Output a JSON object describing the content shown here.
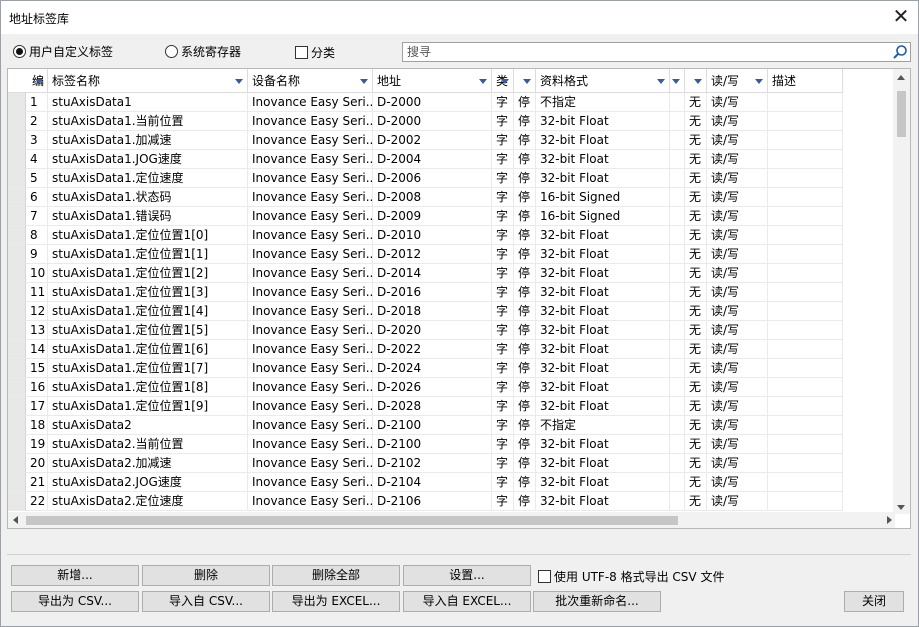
{
  "window": {
    "title": "地址标签库"
  },
  "options": {
    "user_tags_label": "用户自定义标签",
    "system_regs_label": "系统寄存器",
    "category_label": "分类",
    "search_placeholder": "搜寻"
  },
  "columns": [
    "编",
    "标签名称",
    "设备名称",
    "地址",
    "类",
    "",
    "资料格式",
    "",
    "",
    "读/写",
    "描述"
  ],
  "rows": [
    [
      "1",
      "stuAxisData1",
      "Inovance Easy Seri...",
      "D-2000",
      "字",
      "停",
      "不指定",
      "",
      "无",
      "读/写",
      ""
    ],
    [
      "2",
      "stuAxisData1.当前位置",
      "Inovance Easy Seri...",
      "D-2000",
      "字",
      "停",
      "32-bit Float",
      "",
      "无",
      "读/写",
      ""
    ],
    [
      "3",
      "stuAxisData1.加减速",
      "Inovance Easy Seri...",
      "D-2002",
      "字",
      "停",
      "32-bit Float",
      "",
      "无",
      "读/写",
      ""
    ],
    [
      "4",
      "stuAxisData1.JOG速度",
      "Inovance Easy Seri...",
      "D-2004",
      "字",
      "停",
      "32-bit Float",
      "",
      "无",
      "读/写",
      ""
    ],
    [
      "5",
      "stuAxisData1.定位速度",
      "Inovance Easy Seri...",
      "D-2006",
      "字",
      "停",
      "32-bit Float",
      "",
      "无",
      "读/写",
      ""
    ],
    [
      "6",
      "stuAxisData1.状态码",
      "Inovance Easy Seri...",
      "D-2008",
      "字",
      "停",
      "16-bit Signed",
      "",
      "无",
      "读/写",
      ""
    ],
    [
      "7",
      "stuAxisData1.错误码",
      "Inovance Easy Seri...",
      "D-2009",
      "字",
      "停",
      "16-bit Signed",
      "",
      "无",
      "读/写",
      ""
    ],
    [
      "8",
      "stuAxisData1.定位位置1[0]",
      "Inovance Easy Seri...",
      "D-2010",
      "字",
      "停",
      "32-bit Float",
      "",
      "无",
      "读/写",
      ""
    ],
    [
      "9",
      "stuAxisData1.定位位置1[1]",
      "Inovance Easy Seri...",
      "D-2012",
      "字",
      "停",
      "32-bit Float",
      "",
      "无",
      "读/写",
      ""
    ],
    [
      "10",
      "stuAxisData1.定位位置1[2]",
      "Inovance Easy Seri...",
      "D-2014",
      "字",
      "停",
      "32-bit Float",
      "",
      "无",
      "读/写",
      ""
    ],
    [
      "11",
      "stuAxisData1.定位位置1[3]",
      "Inovance Easy Seri...",
      "D-2016",
      "字",
      "停",
      "32-bit Float",
      "",
      "无",
      "读/写",
      ""
    ],
    [
      "12",
      "stuAxisData1.定位位置1[4]",
      "Inovance Easy Seri...",
      "D-2018",
      "字",
      "停",
      "32-bit Float",
      "",
      "无",
      "读/写",
      ""
    ],
    [
      "13",
      "stuAxisData1.定位位置1[5]",
      "Inovance Easy Seri...",
      "D-2020",
      "字",
      "停",
      "32-bit Float",
      "",
      "无",
      "读/写",
      ""
    ],
    [
      "14",
      "stuAxisData1.定位位置1[6]",
      "Inovance Easy Seri...",
      "D-2022",
      "字",
      "停",
      "32-bit Float",
      "",
      "无",
      "读/写",
      ""
    ],
    [
      "15",
      "stuAxisData1.定位位置1[7]",
      "Inovance Easy Seri...",
      "D-2024",
      "字",
      "停",
      "32-bit Float",
      "",
      "无",
      "读/写",
      ""
    ],
    [
      "16",
      "stuAxisData1.定位位置1[8]",
      "Inovance Easy Seri...",
      "D-2026",
      "字",
      "停",
      "32-bit Float",
      "",
      "无",
      "读/写",
      ""
    ],
    [
      "17",
      "stuAxisData1.定位位置1[9]",
      "Inovance Easy Seri...",
      "D-2028",
      "字",
      "停",
      "32-bit Float",
      "",
      "无",
      "读/写",
      ""
    ],
    [
      "18",
      "stuAxisData2",
      "Inovance Easy Seri...",
      "D-2100",
      "字",
      "停",
      "不指定",
      "",
      "无",
      "读/写",
      ""
    ],
    [
      "19",
      "stuAxisData2.当前位置",
      "Inovance Easy Seri...",
      "D-2100",
      "字",
      "停",
      "32-bit Float",
      "",
      "无",
      "读/写",
      ""
    ],
    [
      "20",
      "stuAxisData2.加减速",
      "Inovance Easy Seri...",
      "D-2102",
      "字",
      "停",
      "32-bit Float",
      "",
      "无",
      "读/写",
      ""
    ],
    [
      "21",
      "stuAxisData2.JOG速度",
      "Inovance Easy Seri...",
      "D-2104",
      "字",
      "停",
      "32-bit Float",
      "",
      "无",
      "读/写",
      ""
    ],
    [
      "22",
      "stuAxisData2.定位速度",
      "Inovance Easy Seri...",
      "D-2106",
      "字",
      "停",
      "32-bit Float",
      "",
      "无",
      "读/写",
      ""
    ]
  ],
  "buttons": {
    "new": "新增...",
    "delete": "删除",
    "delete_all": "删除全部",
    "settings": "设置...",
    "export_csv": "导出为 CSV...",
    "import_csv": "导入自 CSV...",
    "export_excel": "导出为 EXCEL...",
    "import_excel": "导入自 EXCEL...",
    "batch_rename": "批次重新命名...",
    "close": "关闭"
  },
  "utf8_option_label": "使用 UTF-8 格式导出 CSV 文件"
}
